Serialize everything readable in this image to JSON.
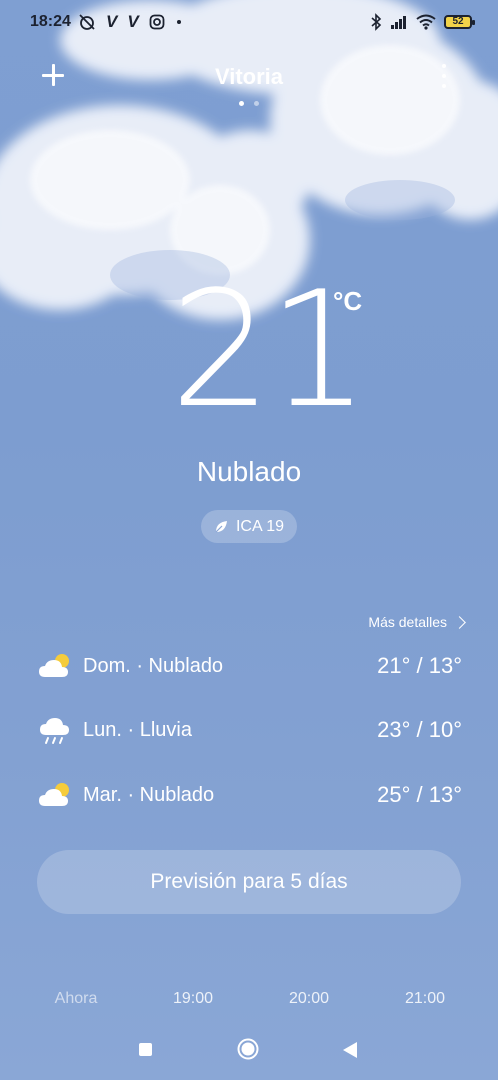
{
  "status_bar": {
    "time": "18:24",
    "left_icons": [
      "alarm-off-icon",
      "v-app-icon",
      "v-app-icon",
      "instagram-icon",
      "dot-icon"
    ],
    "v_label": "V",
    "right_icons": [
      "bluetooth-icon",
      "signal-icon",
      "wifi-icon",
      "battery-icon"
    ],
    "battery": "52"
  },
  "header": {
    "city": "Vitoria",
    "page_count": 2,
    "active_page": 0
  },
  "current": {
    "temperature": "21",
    "unit": "°C",
    "condition": "Nublado",
    "aqi_label": "ICA 19"
  },
  "forecast": {
    "more_label": "Más detalles",
    "days": [
      {
        "label": "Dom. · Nublado",
        "temps": "21° / 13°",
        "icon": "partly-cloudy-icon"
      },
      {
        "label": "Lun. · Lluvia",
        "temps": "23° / 10°",
        "icon": "rain-icon"
      },
      {
        "label": "Mar. · Nublado",
        "temps": "25° / 13°",
        "icon": "partly-cloudy-icon"
      }
    ]
  },
  "button_5day": "Previsión para 5 días",
  "hourly": [
    "Ahora",
    "19:00",
    "20:00",
    "21:00"
  ],
  "colors": {
    "sky": "#7f9fd2",
    "text": "#ffffff",
    "sun": "#f5cc3c"
  }
}
